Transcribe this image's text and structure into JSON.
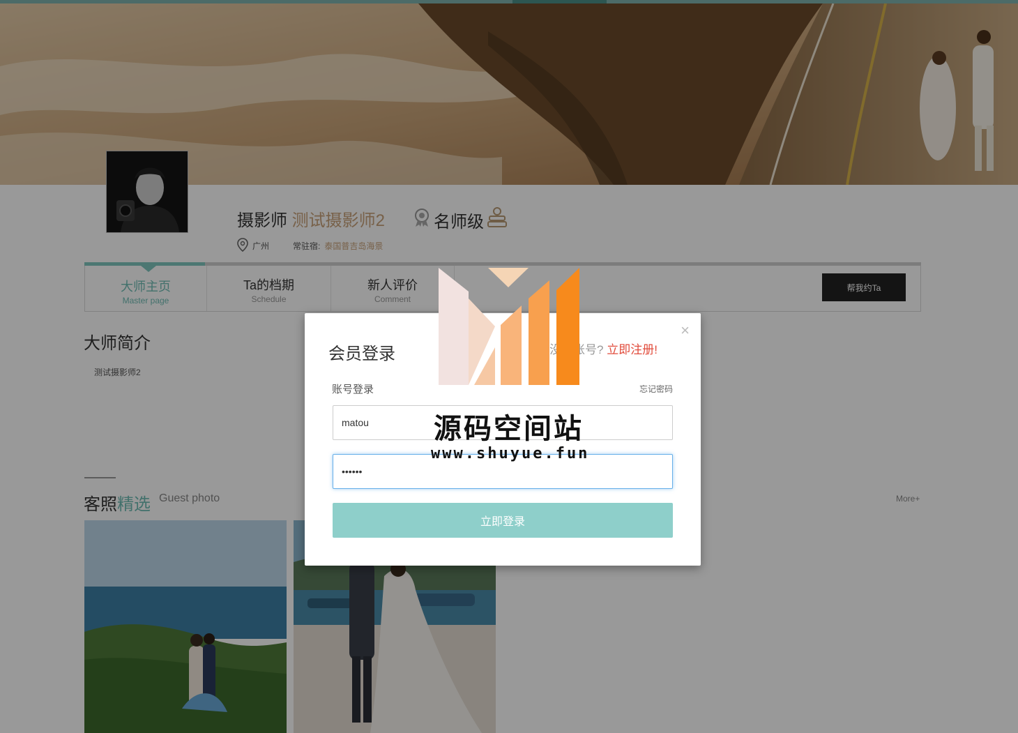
{
  "profile": {
    "role": "摄影师",
    "name": "测试摄影师2",
    "level": "名师级",
    "city": "广州",
    "station_label": "常驻宿:",
    "station": "泰国普吉岛海景"
  },
  "nav": {
    "tabs": [
      {
        "cn": "大师主页",
        "en": "Master page"
      },
      {
        "cn": "Ta的档期",
        "en": "Schedule"
      },
      {
        "cn": "新人评价",
        "en": "Comment"
      }
    ],
    "book_button": "帮我约Ta"
  },
  "intro": {
    "title": "大师简介",
    "text": "测试摄影师2"
  },
  "guest": {
    "title_a": "客照",
    "title_b": "精选",
    "subtitle": "Guest photo",
    "more": "More+"
  },
  "login": {
    "title": "会员登录",
    "register_prefix": "没有账号?",
    "register_link": "立即注册!",
    "close": "×",
    "account_label": "账号登录",
    "forgot": "忘记密码",
    "username": "matou",
    "password": "••••••",
    "submit": "立即登录"
  },
  "watermark": {
    "title": "源码空间站",
    "url": "www.shuyue.fun"
  },
  "colors": {
    "accent": "#7fc7bf",
    "gold": "#c9a27a",
    "register": "#e14b3b",
    "submit": "#8ecfca"
  }
}
